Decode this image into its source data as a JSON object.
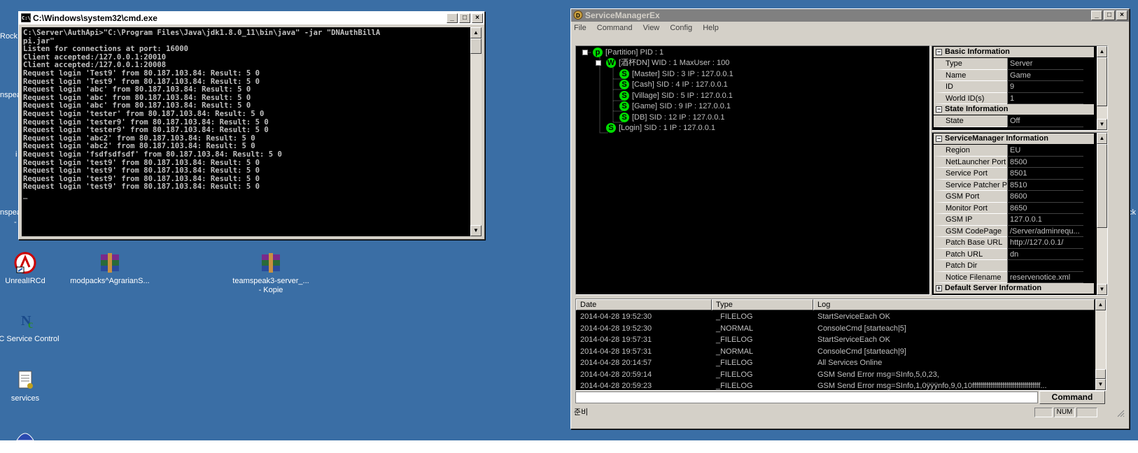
{
  "desktop": {
    "icons": [
      {
        "label": "UnrealIRCd",
        "label2": ""
      },
      {
        "label": "modpacks^AgrarianS...",
        "label2": ""
      },
      {
        "label": "teamspeak3-server_...",
        "label2": "- Kopie"
      },
      {
        "label": "IC Service Control",
        "label2": ""
      },
      {
        "label": "services",
        "label2": ""
      }
    ],
    "edge_texts": [
      "Rock",
      "nspea",
      "nspea",
      "-",
      "i",
      "ck"
    ]
  },
  "cmd_window": {
    "title": "C:\\Windows\\system32\\cmd.exe",
    "lines": [
      "C:\\Server\\AuthApi>\"C:\\Program Files\\Java\\jdk1.8.0_11\\bin\\java\" -jar \"DNAuthBillA",
      "pi.jar\"",
      "Listen for connections at port: 16000",
      "Client accepted:/127.0.0.1:20010",
      "Client accepted:/127.0.0.1:20008",
      "Request login 'Test9' from 80.187.103.84: Result: 5 0",
      "Request login 'Test9' from 80.187.103.84: Result: 5 0",
      "Request login 'abc' from 80.187.103.84: Result: 5 0",
      "Request login 'abc' from 80.187.103.84: Result: 5 0",
      "Request login 'abc' from 80.187.103.84: Result: 5 0",
      "Request login 'tester' from 80.187.103.84: Result: 5 0",
      "Request login 'tester9' from 80.187.103.84: Result: 5 0",
      "Request login 'tester9' from 80.187.103.84: Result: 5 0",
      "Request login 'abc2' from 80.187.103.84: Result: 5 0",
      "Request login 'abc2' from 80.187.103.84: Result: 5 0",
      "Request login 'fsdfsdfsdf' from 80.187.103.84: Result: 5 0",
      "Request login 'test9' from 80.187.103.84: Result: 5 0",
      "Request login 'test9' from 80.187.103.84: Result: 5 0",
      "Request login 'test9' from 80.187.103.84: Result: 5 0",
      "Request login 'test9' from 80.187.103.84: Result: 5 0",
      "_"
    ]
  },
  "sm_window": {
    "title": "ServiceManagerEx",
    "menu": [
      "File",
      "Command",
      "View",
      "Config",
      "Help"
    ],
    "tree": [
      {
        "badge": "p",
        "text": "[Partition] PID : 1"
      },
      {
        "badge": "W",
        "text": "[酒杯DN] WID : 1 MaxUser : 100"
      },
      {
        "badge": "S",
        "text": "[Master] SID : 3 IP : 127.0.0.1"
      },
      {
        "badge": "S",
        "text": "[Cash] SID : 4 IP : 127.0.0.1"
      },
      {
        "badge": "S",
        "text": "[Village] SID : 5 IP : 127.0.0.1"
      },
      {
        "badge": "S",
        "text": "[Game] SID : 9 IP : 127.0.0.1"
      },
      {
        "badge": "S",
        "text": "[DB] SID : 12 IP : 127.0.0.1"
      },
      {
        "badge": "S",
        "text": "[Login] SID : 1 IP : 127.0.0.1"
      }
    ],
    "basic_info": {
      "cat1": "Basic Information",
      "rows1": [
        [
          "Type",
          "Server"
        ],
        [
          "Name",
          "Game"
        ],
        [
          "ID",
          "9"
        ],
        [
          "World ID(s)",
          "1"
        ]
      ],
      "cat2": "State Information",
      "rows2": [
        [
          "State",
          "Off"
        ]
      ]
    },
    "sm_info": {
      "cat": "ServiceManager Information",
      "rows": [
        [
          "Region",
          "EU"
        ],
        [
          "NetLauncher Port",
          "8500"
        ],
        [
          "Service Port",
          "8501"
        ],
        [
          "Service Patcher Port",
          "8510"
        ],
        [
          "GSM Port",
          "8600"
        ],
        [
          "Monitor Port",
          "8650"
        ],
        [
          "GSM IP",
          "127.0.0.1"
        ],
        [
          "GSM CodePage",
          "/Server/adminrequ..."
        ],
        [
          "Patch Base URL",
          "http://127.0.0.1/"
        ],
        [
          "Patch URL",
          "dn"
        ],
        [
          "Patch Dir",
          ""
        ],
        [
          "Notice Filename",
          "reservenotice.xml"
        ]
      ],
      "cat2": "Default Server Information"
    },
    "log": {
      "headers": [
        "Date",
        "Type",
        "Log"
      ],
      "rows": [
        [
          "2014-04-28 19:52:30",
          "_FILELOG",
          "StartServiceEach OK"
        ],
        [
          "2014-04-28 19:52:30",
          "_NORMAL",
          "ConsoleCmd [starteach|5]"
        ],
        [
          "2014-04-28 19:57:31",
          "_FILELOG",
          "StartServiceEach OK"
        ],
        [
          "2014-04-28 19:57:31",
          "_NORMAL",
          "ConsoleCmd [starteach|9]"
        ],
        [
          "2014-04-28 20:14:57",
          "_FILELOG",
          "All Services Online"
        ],
        [
          "2014-04-28 20:59:14",
          "_FILELOG",
          "GSM Send Error msg=SInfo,5,0,23,"
        ],
        [
          "2014-04-28 20:59:23",
          "_FILELOG",
          "GSM Send Error msg=SInfo,1,0ÿÿÿnfo,9,0,10ffffffffffffffffffffffffffffffffff..."
        ]
      ]
    },
    "command_label": "Command",
    "command_value": "",
    "status_text": "준비",
    "status_num": "NUM"
  },
  "colors": {
    "desktop": "#3a6ea5",
    "active_title": "#0a246a",
    "node_green": "#00dd00"
  }
}
